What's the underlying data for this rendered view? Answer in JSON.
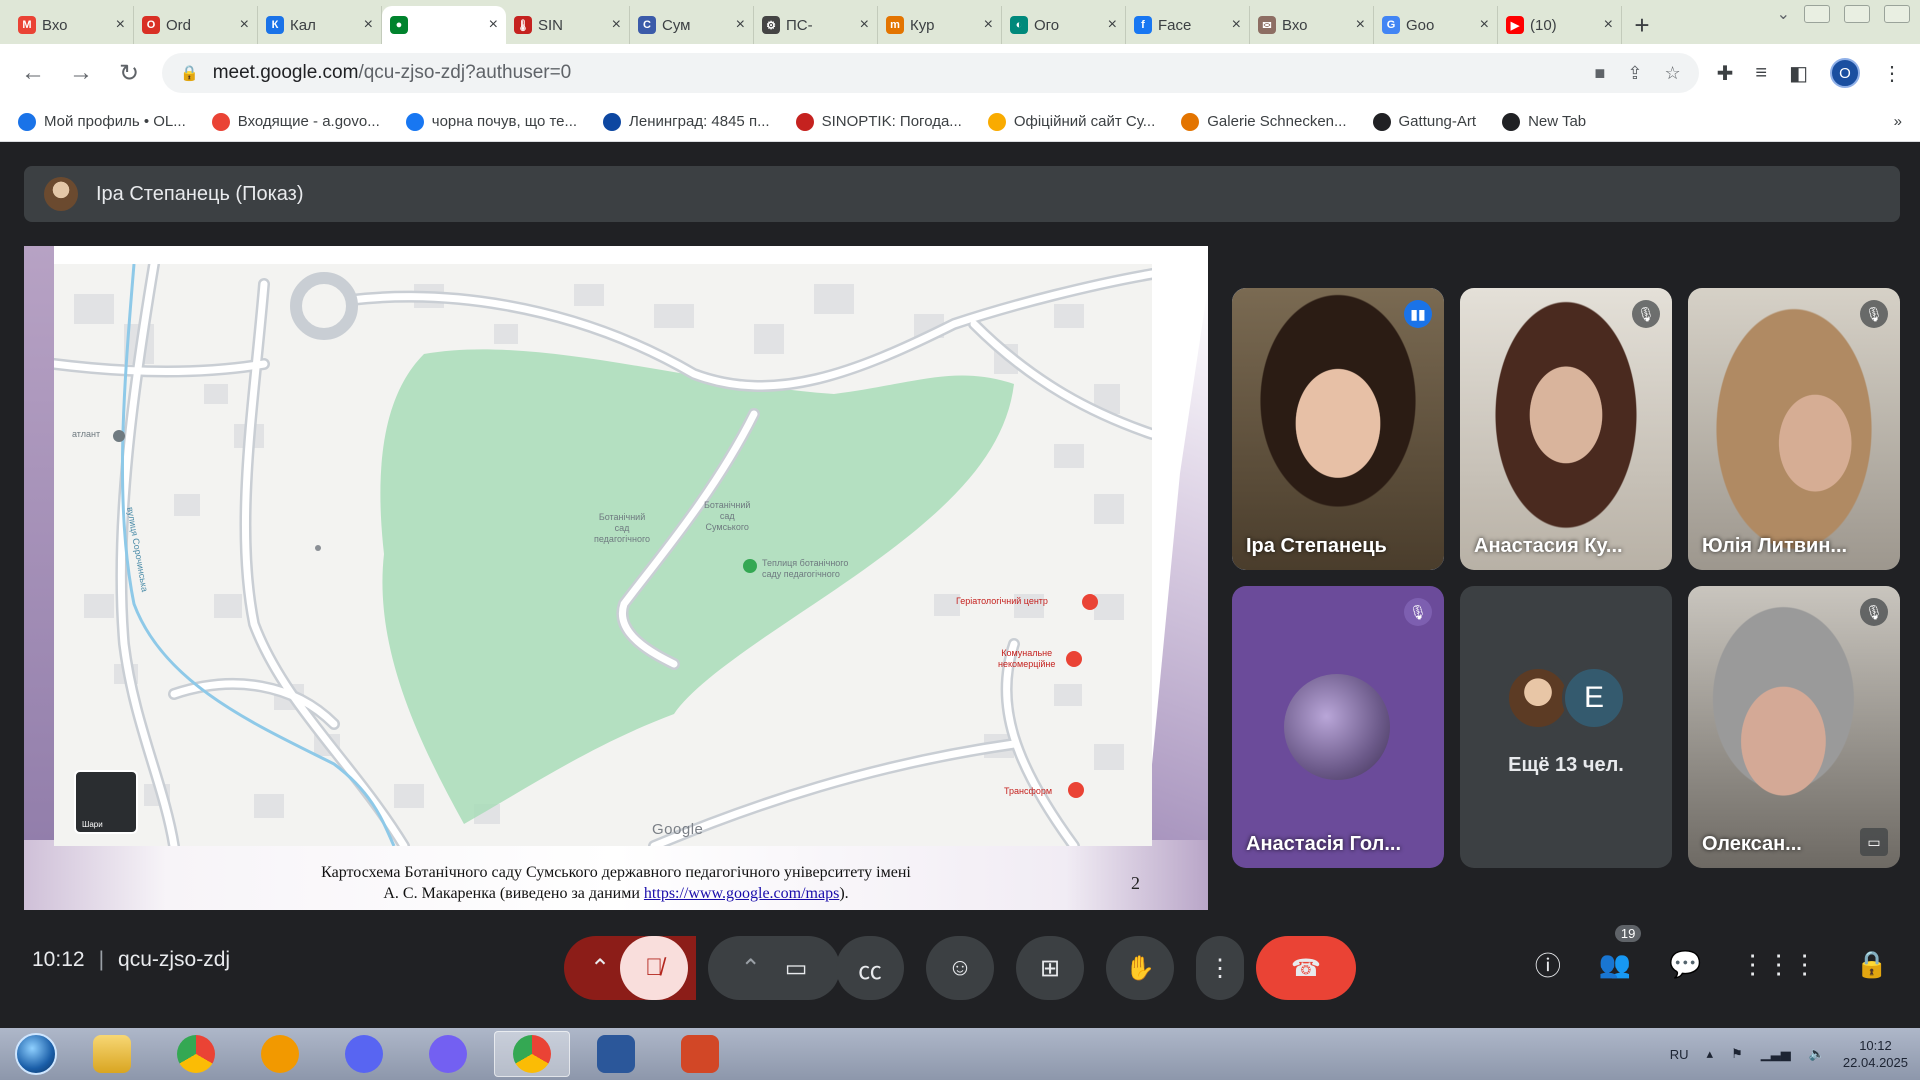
{
  "browser": {
    "tabs": [
      {
        "label": "Вхо",
        "color": "#ea4335",
        "glyph": "M"
      },
      {
        "label": "Ord",
        "color": "#d93025",
        "glyph": "O"
      },
      {
        "label": "Кал",
        "color": "#1a73e8",
        "glyph": "К"
      },
      {
        "label": "",
        "color": "#00832d",
        "glyph": "●",
        "active": true
      },
      {
        "label": "SIN",
        "color": "#c5221f",
        "glyph": "🌡"
      },
      {
        "label": "Сум",
        "color": "#3b5ba9",
        "glyph": "С"
      },
      {
        "label": "ПС-",
        "color": "#444444",
        "glyph": "⚙"
      },
      {
        "label": "Кур",
        "color": "#e37400",
        "glyph": "m"
      },
      {
        "label": "Ого",
        "color": "#00897b",
        "glyph": "◐"
      },
      {
        "label": "Face",
        "color": "#1877f2",
        "glyph": "f"
      },
      {
        "label": "Вхо",
        "color": "#8d6e63",
        "glyph": "✉"
      },
      {
        "label": "Goo",
        "color": "#4285f4",
        "glyph": "G"
      },
      {
        "label": "(10)",
        "color": "#ff0000",
        "glyph": "▶"
      }
    ],
    "new_tab_glyph": "+",
    "url_host": "meet.google.com",
    "url_path": "/qcu-zjso-zdj?authuser=0",
    "profile_initial": "O",
    "bookmarks": [
      {
        "label": "Мой профиль • OL...",
        "color": "#1a73e8"
      },
      {
        "label": "Входящие - a.govo...",
        "color": "#ea4335"
      },
      {
        "label": "чорна почув, що те...",
        "color": "#1877f2"
      },
      {
        "label": "Ленинград: 4845 п...",
        "color": "#0d47a1"
      },
      {
        "label": "SINOPTIK: Погода...",
        "color": "#c5221f"
      },
      {
        "label": "Офіційний сайт Су...",
        "color": "#f9ab00"
      },
      {
        "label": "Galerie Schnecken...",
        "color": "#e37400"
      },
      {
        "label": "Gattung-Art",
        "color": "#202124"
      },
      {
        "label": "New Tab",
        "color": "#202124"
      }
    ]
  },
  "meet": {
    "presenter_label": "Іра Степанець (Показ)",
    "slide": {
      "caption_line1": "Картосхема Ботанічного саду Сумського державного педагогічного університету імені",
      "caption_line2_prefix": "А. С. Макаренка (виведено за даними ",
      "caption_link": "https://www.google.com/maps",
      "caption_line2_suffix": ").",
      "slide_number": "2",
      "map_labels": {
        "garden": "Ботанічний\nсад\nпедагогічного",
        "garden2": "Ботанічний\nсад\nСумського",
        "greenhouse": "Теплиця ботанічного\nсаду педагогічного",
        "center": "Геріатологічний центр",
        "communal": "Комунальне\nнекомерційне",
        "transport": "Трансформ",
        "street1": "вулиця Сорочинська",
        "street2": "атлант",
        "google": "Google",
        "layers": "Шари"
      }
    },
    "participants": [
      {
        "name": "Іра Степанець",
        "speaking": true
      },
      {
        "name": "Анастасия Ку...",
        "muted": true
      },
      {
        "name": "Юлія Литвин...",
        "muted": true
      },
      {
        "name": "Анастасія Гол...",
        "muted": true
      },
      {
        "name": "Олексан...",
        "muted": true
      }
    ],
    "more": {
      "text": "Ещё 13 чел.",
      "letter": "E"
    },
    "time": "10:12",
    "meeting_code": "qcu-zjso-zdj",
    "participants_count": "19"
  },
  "taskbar": {
    "lang": "RU",
    "time": "10:12",
    "date": "22.04.2025"
  }
}
